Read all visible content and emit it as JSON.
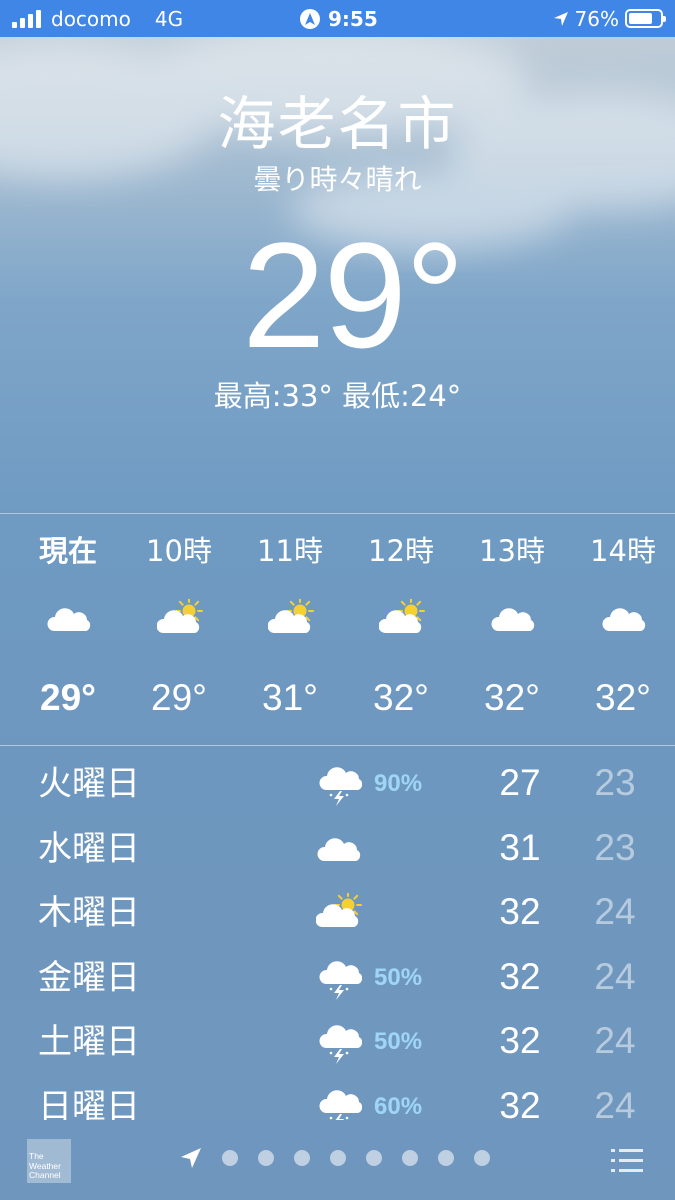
{
  "status_bar": {
    "carrier": "docomo",
    "network": "4G",
    "time": "9:55",
    "battery_percent": "76%",
    "battery_level": 0.76,
    "signal_bars": 4
  },
  "header": {
    "city": "海老名市",
    "condition": "曇り時々晴れ",
    "temperature": "29°",
    "hi_lo": "最高:33° 最低:24°"
  },
  "hourly": [
    {
      "label": "現在",
      "icon": "cloud-icon",
      "temp": "29°",
      "bold": true
    },
    {
      "label": "10時",
      "icon": "partly-sunny-icon",
      "temp": "29°"
    },
    {
      "label": "11時",
      "icon": "partly-sunny-icon",
      "temp": "31°"
    },
    {
      "label": "12時",
      "icon": "partly-sunny-icon",
      "temp": "32°"
    },
    {
      "label": "13時",
      "icon": "cloud-icon",
      "temp": "32°"
    },
    {
      "label": "14時",
      "icon": "cloud-icon",
      "temp": "32°"
    }
  ],
  "daily": [
    {
      "day": "火曜日",
      "icon": "thunderstorm-icon",
      "pop": "90%",
      "high": "27",
      "low": "23"
    },
    {
      "day": "水曜日",
      "icon": "cloud-icon",
      "pop": "",
      "high": "31",
      "low": "23"
    },
    {
      "day": "木曜日",
      "icon": "partly-sunny-icon",
      "pop": "",
      "high": "32",
      "low": "24"
    },
    {
      "day": "金曜日",
      "icon": "thunderstorm-icon",
      "pop": "50%",
      "high": "32",
      "low": "24"
    },
    {
      "day": "土曜日",
      "icon": "thunderstorm-icon",
      "pop": "50%",
      "high": "32",
      "low": "24"
    },
    {
      "day": "日曜日",
      "icon": "thunderstorm-icon",
      "pop": "60%",
      "high": "32",
      "low": "24"
    }
  ],
  "bottom_bar": {
    "logo_text": "The Weather Channel",
    "page_dots": 8
  },
  "colors": {
    "status_bar_bg": "#3f86e6",
    "precip_text": "#9fd6f5",
    "sun_yellow": "#f5d033"
  }
}
